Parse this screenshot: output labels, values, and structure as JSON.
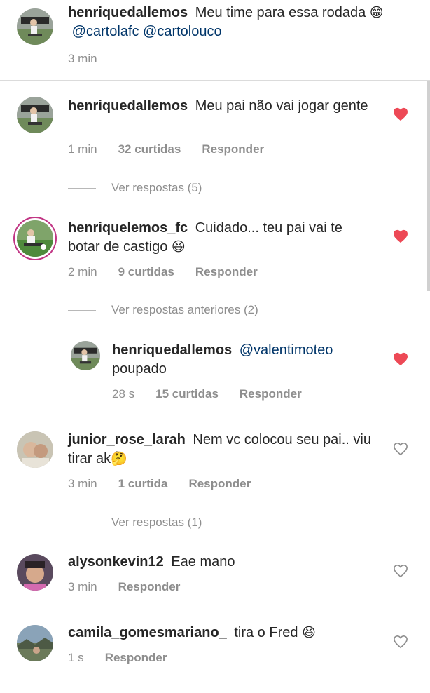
{
  "caption": {
    "username": "henriquedallemos",
    "text": "Meu time para essa rodada",
    "emoji": "😁",
    "mention1": "@cartolafc",
    "mention2": "@cartolouco",
    "time": "3 min"
  },
  "comments": [
    {
      "username": "henriquedallemos",
      "text": "Meu pai não vai jogar gente",
      "time": "1 min",
      "likes": "32 curtidas",
      "reply_label": "Responder",
      "view_replies": "Ver respostas (5)",
      "liked": true,
      "heart_icon": "heart-filled-icon"
    },
    {
      "username": "henriquelemos_fc",
      "text": "Cuidado... teu pai vai te botar de castigo",
      "emoji": "😆",
      "time": "2 min",
      "likes": "9 curtidas",
      "reply_label": "Responder",
      "view_replies": "Ver respostas anteriores (2)",
      "liked": true,
      "heart_icon": "heart-filled-icon"
    },
    {
      "username": "henriquedallemos",
      "mention": "@valentimoteo",
      "text": "poupado",
      "time": "28 s",
      "likes": "15 curtidas",
      "reply_label": "Responder",
      "liked": true,
      "heart_icon": "heart-filled-icon"
    },
    {
      "username": "junior_rose_larah",
      "text": "Nem vc colocou seu pai.. viu tirar ak",
      "emoji": "🤔",
      "time": "3 min",
      "likes": "1 curtida",
      "reply_label": "Responder",
      "view_replies": "Ver respostas (1)",
      "liked": false,
      "heart_icon": "heart-outline-icon"
    },
    {
      "username": "alysonkevin12",
      "text": "Eae mano",
      "time": "3 min",
      "reply_label": "Responder",
      "liked": false,
      "heart_icon": "heart-outline-icon"
    },
    {
      "username": "camila_gomesmariano_",
      "text": "tira o Fred",
      "emoji": "😆",
      "time": "1 s",
      "reply_label": "Responder",
      "liked": false,
      "heart_icon": "heart-outline-icon"
    }
  ],
  "colors": {
    "liked_heart": "#ed4956",
    "meta_text": "#8e8e8e",
    "username_text": "#262626",
    "mention": "#003569"
  }
}
